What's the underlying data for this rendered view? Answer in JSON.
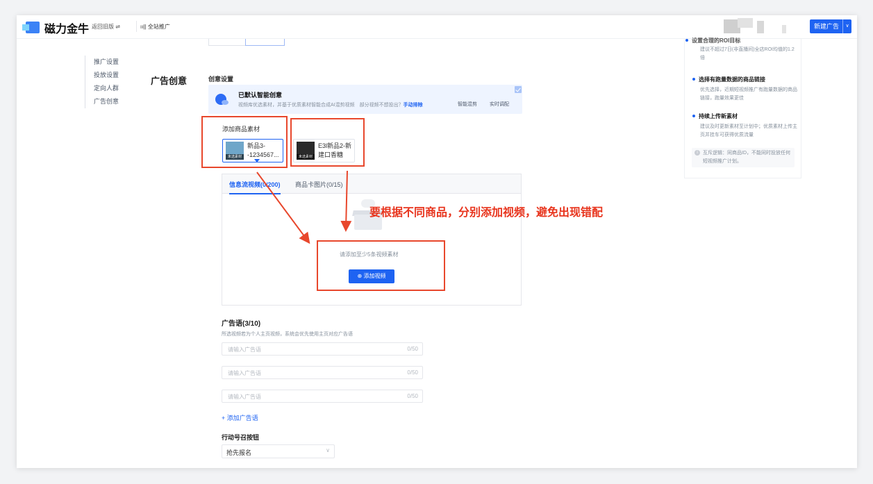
{
  "header": {
    "logo_text": "磁力金牛",
    "old_version": "返回旧版 ⇌",
    "full_promo": "ıı|| 全站推广",
    "new_ad_button": "新建广告",
    "new_ad_dropdown": "∨"
  },
  "sidebar": {
    "items": [
      {
        "label": "推广设置"
      },
      {
        "label": "投放设置"
      },
      {
        "label": "定向人群"
      },
      {
        "label": "广告创意"
      }
    ]
  },
  "main": {
    "section_title": "广告创意",
    "sub_title": "创意设置",
    "smart": {
      "title": "已默认智能创意",
      "desc": "视频库优选素材，并基于优质素材智能合成AI混剪视频　部分视频不想投出？",
      "link": "手动排除",
      "chip1": "智能混剪",
      "chip2": "实时调配"
    },
    "add_material_label": "添加商品素材",
    "products": [
      {
        "name": "新品3-\n-1234567...",
        "tag": "未选素材"
      },
      {
        "name": "E3l新品2-新\n建口香糖",
        "tag": "未选素材"
      }
    ],
    "tabs": [
      {
        "label": "信息流视频(0/200)"
      },
      {
        "label": "商品卡图片(0/15)"
      }
    ],
    "empty_text": "请添加至少5条视频素材",
    "add_video_button": "⊕ 添加视频",
    "annotation": "要根据不同商品，分别添加视频，避免出现错配",
    "ad_words": {
      "title": "广告语(3/10)",
      "desc": "所选视频若为个人主页视频，系统会优先使用主页对应广告语",
      "inputs": [
        {
          "placeholder": "请输入广告语",
          "count": "0/50"
        },
        {
          "placeholder": "请输入广告语",
          "count": "0/50"
        },
        {
          "placeholder": "请输入广告语",
          "count": "0/50"
        }
      ],
      "add_label": "+ 添加广告语"
    },
    "cta": {
      "title": "行动号召按钮",
      "value": "抢先报名",
      "arrow": "∨"
    }
  },
  "tips": {
    "t1_title": "设置合理的ROI目标",
    "t1_desc": "建议不超过7日(非直播间)全店ROI均值的1.2倍",
    "t2_title": "选择有跑量数据的商品链接",
    "t2_desc": "优先选择，近期短视频推广有跑量数据的商品链接，跑量效果更佳",
    "t3_title": "持续上传新素材",
    "t3_desc": "建议及时更新素材至计划中；优质素材上传主页并挂车可获得优质流量",
    "note": "互斥逻辑：同商品ID，不能同时投放任何短视频推广计划。"
  },
  "colors": {
    "brand": "#1e63f2",
    "annotation_red": "#e8351e"
  }
}
